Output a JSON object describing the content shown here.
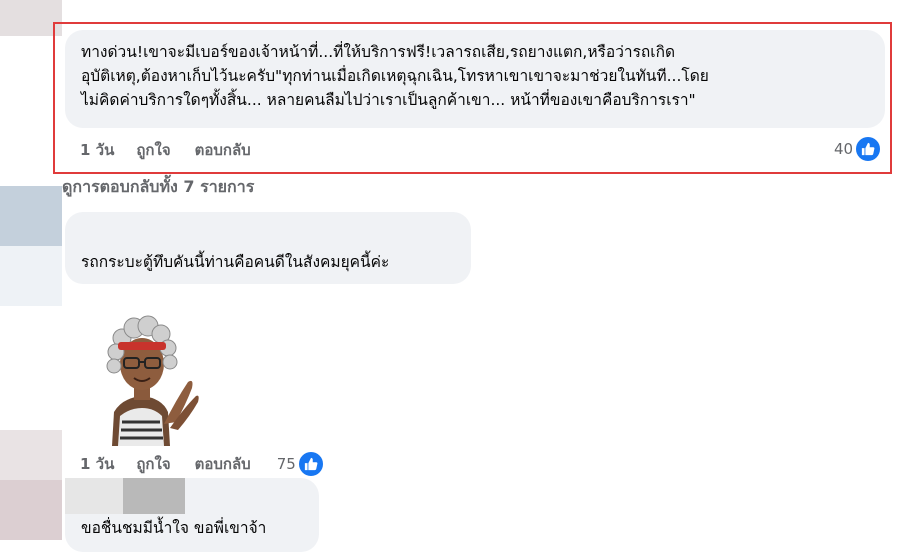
{
  "comments": [
    {
      "text_lines": [
        "ทางด่วน!เขาจะมีเบอร์ของเจ้าหน้าที่...ที่ให้บริการฟรี!เวลารถเสีย,รถยางแตก,หรือว่ารถเกิด",
        "อุบัติเหตุ,ต้องหาเก็บไว้นะครับ\"ทุกท่านเมื่อเกิดเหตุฉุกเฉิน,โทรหาเขาเขาจะมาช่วยในทันที...โดย",
        "ไม่คิดค่าบริการใดๆทั้งสิ้น... หลายคนลืมไปว่าเราเป็นลูกค้าเขา... หน้าที่ของเขาคือบริการเรา\""
      ],
      "time": "1 วัน",
      "like_label": "ถูกใจ",
      "reply_label": "ตอบกลับ",
      "like_count": "40"
    },
    {
      "text": "รถกระบะตู้ทึบคันนี้ท่านคือคนดีในสังคมยุคนี้ค่ะ"
    },
    {
      "sticker": "applauding-avatar-sticker",
      "time": "1 วัน",
      "like_label": "ถูกใจ",
      "reply_label": "ตอบกลับ",
      "like_count": "75"
    },
    {
      "text": "ขอชื่นชมมีน้ำใจ ขอพี่เขาจ้า"
    }
  ],
  "view_replies": "ดูการตอบกลับทั้ง 7 รายการ",
  "icons": {
    "like": "thumbs-up-icon"
  },
  "colors": {
    "accent": "#1877f2",
    "highlight": "#e03b3b",
    "bubble": "#f0f2f5",
    "meta": "#65676b"
  }
}
